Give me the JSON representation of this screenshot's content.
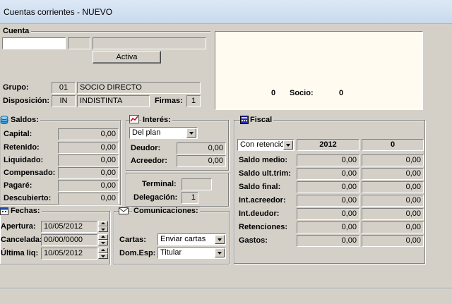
{
  "window": {
    "title": "Cuentas corrientes - NUEVO"
  },
  "cuenta": {
    "section_label": "Cuenta",
    "field1": "",
    "field2": "",
    "field3": "",
    "status_button": "Activa",
    "grupo_label": "Grupo:",
    "grupo_code": "01",
    "grupo_name": "SOCIO DIRECTO",
    "disposicion_label": "Disposición:",
    "disposicion_code": "IN",
    "disposicion_name": "INDISTINTA",
    "firmas_label": "Firmas:",
    "firmas_value": "1",
    "info_left": "0",
    "socio_label": "Socio:",
    "socio_value": "0"
  },
  "saldos": {
    "title": "Saldos:",
    "rows": [
      {
        "label": "Capital:",
        "value": "0,00"
      },
      {
        "label": "Retenido:",
        "value": "0,00"
      },
      {
        "label": "Liquidado:",
        "value": "0,00"
      },
      {
        "label": "Compensado:",
        "value": "0,00"
      },
      {
        "label": "Pagaré:",
        "value": "0,00"
      },
      {
        "label": "Descubierto:",
        "value": "0,00"
      }
    ]
  },
  "interes": {
    "title": "Interés:",
    "plan_select": "Del plan",
    "deudor_label": "Deudor:",
    "deudor_value": "0,00",
    "acreedor_label": "Acreedor:",
    "acreedor_value": "0,00",
    "terminal_label": "Terminal:",
    "terminal_value": "",
    "delegacion_label": "Delegación:",
    "delegacion_value": "1"
  },
  "fiscal": {
    "title": "Fiscal",
    "retencion_select": "Con retenció",
    "year": "2012",
    "col2_header": "0",
    "rows": [
      {
        "label": "Saldo medio:",
        "v1": "0,00",
        "v2": "0,00"
      },
      {
        "label": "Saldo ult.trim:",
        "v1": "0,00",
        "v2": "0,00"
      },
      {
        "label": "Saldo final:",
        "v1": "0,00",
        "v2": "0,00"
      },
      {
        "label": "Int.acreedor:",
        "v1": "0,00",
        "v2": "0,00"
      },
      {
        "label": "Int.deudor:",
        "v1": "0,00",
        "v2": "0,00"
      },
      {
        "label": "Retenciones:",
        "v1": "0,00",
        "v2": "0,00"
      },
      {
        "label": "Gastos:",
        "v1": "0,00",
        "v2": "0,00"
      }
    ]
  },
  "fechas": {
    "title": "Fechas:",
    "apertura_label": "Apertura:",
    "apertura_value": "10/05/2012",
    "cancelada_label": "Cancelada:",
    "cancelada_value": "00/00/0000",
    "ultima_label": "Última liq:",
    "ultima_value": "10/05/2012"
  },
  "comunicaciones": {
    "title": "Comunicaciones:",
    "cartas_label": "Cartas:",
    "cartas_value": "Enviar cartas",
    "domesp_label": "Dom.Esp:",
    "domesp_value": "Titular"
  }
}
